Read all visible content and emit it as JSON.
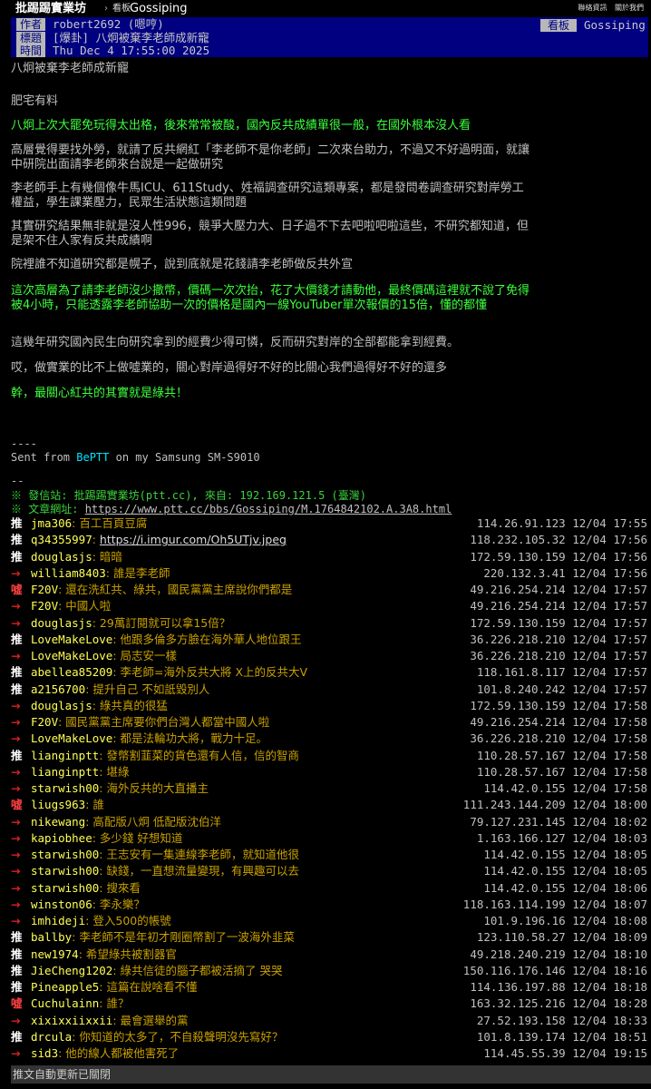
{
  "nav": {
    "brand": "批踢踢實業坊",
    "separator": "›",
    "board_prefix": "看板",
    "board": "Gossiping",
    "links": [
      "聯絡資訊",
      "關於我們"
    ]
  },
  "meta": {
    "author_label": "作者",
    "author": "robert2692 (嗯哼)",
    "title_label": "標題",
    "title": "[爆卦] 八炯被棄李老師成新寵",
    "time_label": "時間",
    "time": "Thu Dec  4 17:55:00 2025",
    "board_label": "看板",
    "board": "Gossiping"
  },
  "article": {
    "p1": "八炯被棄李老師成新寵",
    "p2": "肥宅有料",
    "p3": "八炯上次大罷免玩得太出格，後來常常被酸，國內反共成績單很一般，在國外根本沒人看",
    "p4": "高層覺得要找外勞，就請了反共網紅「李老師不是你老師」二次來台助力，不過又不好過明面，就讓中研院出面請李老師來台說是一起做研究",
    "p5": "李老師手上有幾個像牛馬ICU、611Study、姓福調查研究這類專案，都是發問卷調查研究對岸勞工權益，學生課業壓力，民眾生活狀態這類問題",
    "p6": "其實研究結果無非就是沒人性996，競爭大壓力大、日子過不下去吧啦吧啦這些，不研究都知道，但是架不住人家有反共成績啊",
    "p7": "院裡誰不知道研究都是幌子，說到底就是花錢請李老師做反共外宣",
    "p8": "這次高層為了請李老師沒少撒幣，價碼一次次抬，花了大價錢才請動他，最終價碼這裡就不說了免得被4小時，只能透露李老師協助一次的價格是國內一線YouTuber單次報價的15倍，懂的都懂",
    "p9": "這幾年研究國內民生向研究拿到的經費少得可憐，反而研究對岸的全部都能拿到經費。",
    "p10": "哎，做實業的比不上做噓業的，關心對岸過得好不好的比關心我們過得好不好的還多",
    "p11": "幹，最關心紅共的其實就是綠共！",
    "sig_dash": "----",
    "sig_pre": "Sent from ",
    "sig_app": "BePTT",
    "sig_post": " on my Samsung SM-S9010",
    "sig_end": "--",
    "sys1": "※ 發信站: 批踢踢實業坊(ptt.cc), 來自: 192.169.121.5 (臺灣)",
    "sys2_label": "※ 文章網址: ",
    "sys2_url": "https://www.ptt.cc/bbs/Gossiping/M.1764842102.A.3A8.html"
  },
  "pushes": [
    {
      "tag": "推",
      "type": "push",
      "user": "jma306",
      "text": ": 百工百頁豆腐",
      "ip": "114.26.91.123 12/04 17:55"
    },
    {
      "tag": "推",
      "type": "push",
      "user": "q34355997",
      "text": ": ",
      "link": "https://i.imgur.com/Oh5UTjv.jpeg",
      "ip": "118.232.105.32 12/04 17:56"
    },
    {
      "tag": "推",
      "type": "push",
      "user": "douglasjs",
      "text": ": 暗暗",
      "ip": "172.59.130.159 12/04 17:56"
    },
    {
      "tag": "→",
      "type": "arrow",
      "user": "william8403",
      "text": ": 誰是李老師",
      "ip": "220.132.3.41 12/04 17:56"
    },
    {
      "tag": "噓",
      "type": "boo",
      "user": "F20V",
      "text": ": 還在洗紅共、綠共，國民黨黨主席說你們都是",
      "ip": "49.216.254.214 12/04 17:57"
    },
    {
      "tag": "→",
      "type": "arrow",
      "user": "F20V",
      "text": ": 中國人啦",
      "ip": "49.216.254.214 12/04 17:57"
    },
    {
      "tag": "→",
      "type": "arrow",
      "user": "douglasjs",
      "text": ": 29萬訂閱就可以拿15倍？",
      "ip": "172.59.130.159 12/04 17:57"
    },
    {
      "tag": "推",
      "type": "push",
      "user": "LoveMakeLove",
      "text": ": 他跟多倫多方臉在海外華人地位跟王",
      "ip": "36.226.218.210 12/04 17:57"
    },
    {
      "tag": "→",
      "type": "arrow",
      "user": "LoveMakeLove",
      "text": ": 局志安一樣",
      "ip": "36.226.218.210 12/04 17:57"
    },
    {
      "tag": "推",
      "type": "push",
      "user": "abellea85209",
      "text": ": 李老師=海外反共大將 X上的反共大V",
      "ip": "118.161.8.117 12/04 17:57"
    },
    {
      "tag": "推",
      "type": "push",
      "user": "a2156700",
      "text": ": 提升自己 不如詆毀別人",
      "ip": "101.8.240.242 12/04 17:57"
    },
    {
      "tag": "→",
      "type": "arrow",
      "user": "douglasjs",
      "text": ": 綠共真的很猛",
      "ip": "172.59.130.159 12/04 17:58"
    },
    {
      "tag": "→",
      "type": "arrow",
      "user": "F20V",
      "text": ": 國民黨黨主席要你們台灣人都當中國人啦",
      "ip": "49.216.254.214 12/04 17:58"
    },
    {
      "tag": "→",
      "type": "arrow",
      "user": "LoveMakeLove",
      "text": ": 都是法輪功大將，戰力十足。",
      "ip": "36.226.218.210 12/04 17:58"
    },
    {
      "tag": "推",
      "type": "push",
      "user": "lianginptt",
      "text": ": 發幣割韮菜的貨色還有人信，信的智商",
      "ip": "110.28.57.167 12/04 17:58"
    },
    {
      "tag": "→",
      "type": "arrow",
      "user": "lianginptt",
      "text": ": 堪綠",
      "ip": "110.28.57.167 12/04 17:58"
    },
    {
      "tag": "→",
      "type": "arrow",
      "user": "starwish00",
      "text": ": 海外反共的大直播主",
      "ip": "114.42.0.155 12/04 17:58"
    },
    {
      "tag": "噓",
      "type": "boo",
      "user": "liugs963",
      "text": ": 誰",
      "ip": "111.243.144.209 12/04 18:00"
    },
    {
      "tag": "→",
      "type": "arrow",
      "user": "nikewang",
      "text": ": 高配版八炯 低配版沈伯洋",
      "ip": "79.127.231.145 12/04 18:02"
    },
    {
      "tag": "→",
      "type": "arrow",
      "user": "kapiobhee",
      "text": ": 多少錢 好想知道",
      "ip": "1.163.166.127 12/04 18:03"
    },
    {
      "tag": "→",
      "type": "arrow",
      "user": "starwish00",
      "text": ": 王志安有一集連線李老師，就知道他很",
      "ip": "114.42.0.155 12/04 18:05"
    },
    {
      "tag": "→",
      "type": "arrow",
      "user": "starwish00",
      "text": ": 缺錢，一直想流量變現，有興趣可以去",
      "ip": "114.42.0.155 12/04 18:05"
    },
    {
      "tag": "→",
      "type": "arrow",
      "user": "starwish00",
      "text": ": 搜來看",
      "ip": "114.42.0.155 12/04 18:06"
    },
    {
      "tag": "→",
      "type": "arrow",
      "user": "winston06",
      "text": ": 李永樂？",
      "ip": "118.163.114.199 12/04 18:07"
    },
    {
      "tag": "→",
      "type": "arrow",
      "user": "imhideji",
      "text": ": 登入500的帳號",
      "ip": "101.9.196.16 12/04 18:08"
    },
    {
      "tag": "推",
      "type": "push",
      "user": "ballby",
      "text": ": 李老師不是年初才剛圈幣割了一波海外韭菜",
      "ip": "123.110.58.27 12/04 18:09"
    },
    {
      "tag": "推",
      "type": "push",
      "user": "new1974",
      "text": ": 希望綠共被割器官",
      "ip": "49.218.240.219 12/04 18:10"
    },
    {
      "tag": "推",
      "type": "push",
      "user": "JieCheng1202",
      "text": ": 綠共信徒的腦子都被活摘了 哭哭",
      "ip": "150.116.176.146 12/04 18:16"
    },
    {
      "tag": "推",
      "type": "push",
      "user": "Pineapple5",
      "text": ": 這篇在說啥看不懂",
      "ip": "114.136.197.88 12/04 18:18"
    },
    {
      "tag": "噓",
      "type": "boo",
      "user": "Cuchulainn",
      "text": ": 誰？",
      "ip": "163.32.125.216 12/04 18:28"
    },
    {
      "tag": "→",
      "type": "arrow",
      "user": "xixixxiixxii",
      "text": ": 最會選舉的黨",
      "ip": "27.52.193.158 12/04 18:33"
    },
    {
      "tag": "推",
      "type": "push",
      "user": "drcula",
      "text": ": 你知道的太多了，不自殺聲明沒先寫好？",
      "ip": "101.8.139.174 12/04 18:51"
    },
    {
      "tag": "→",
      "type": "arrow",
      "user": "sid3",
      "text": ": 他的線人都被他害死了",
      "ip": "114.45.55.39 12/04 19:15"
    }
  ],
  "footer": {
    "status": "推文自動更新已關閉"
  }
}
